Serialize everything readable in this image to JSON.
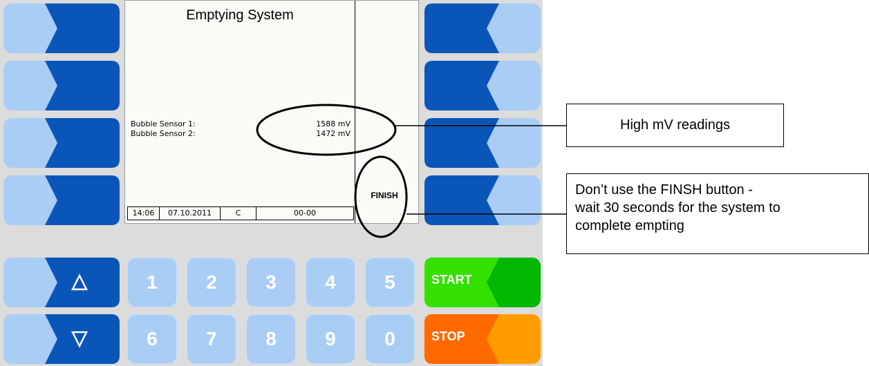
{
  "screen": {
    "title": "Emptying System",
    "sensors": [
      {
        "label": "Bubble Sensor 1:",
        "value": "1588 mV"
      },
      {
        "label": "Bubble Sensor 2:",
        "value": "1472 mV"
      }
    ],
    "finish_label": "FINISH",
    "status": {
      "time": "14:06",
      "date": "07.10.2011",
      "mode": "C",
      "code": "00-00"
    }
  },
  "keypad": {
    "row1": [
      "1",
      "2",
      "3",
      "4",
      "5"
    ],
    "row2": [
      "6",
      "7",
      "8",
      "9",
      "0"
    ],
    "start_label": "START",
    "stop_label": "STOP",
    "up_icon": "triangle-up-icon",
    "down_icon": "triangle-down-icon"
  },
  "callouts": {
    "readings": "High mV readings",
    "finish_line1": "Don’t use the FINSH button -",
    "finish_line2": "wait 30 seconds for the system to",
    "finish_line3": "complete empting"
  },
  "colors": {
    "key_dark": "#0a56b8",
    "key_light": "#a9cdf5",
    "start": "#34e000",
    "start_right": "#00b800",
    "stop": "#ff6a00",
    "stop_right": "#ff9d00",
    "panel": "#dcdcdc"
  }
}
